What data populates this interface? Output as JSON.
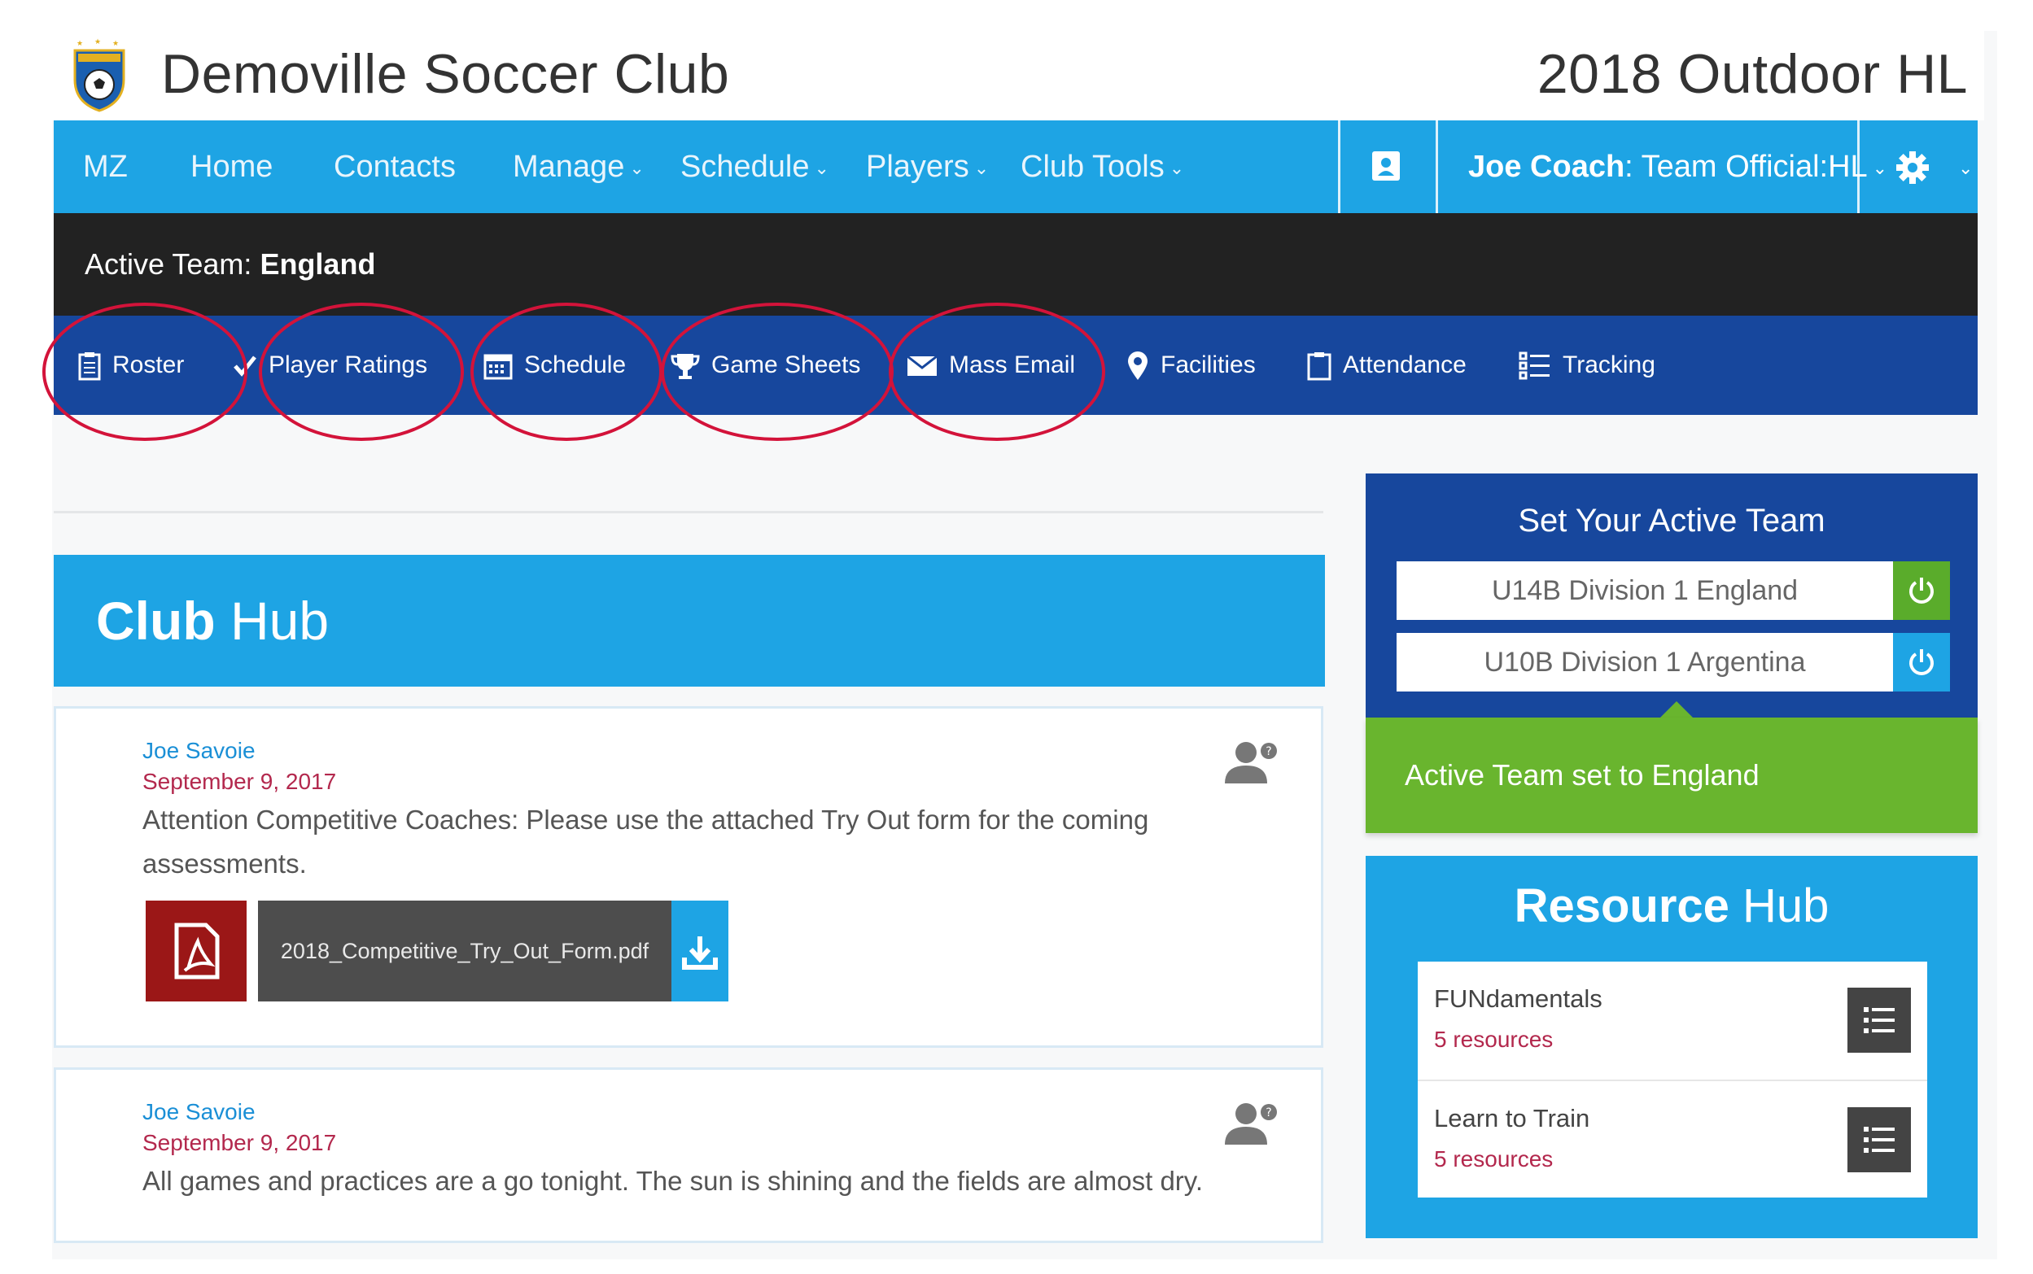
{
  "header": {
    "club_name": "Demoville Soccer Club",
    "season": "2018 Outdoor HL"
  },
  "main_nav": {
    "items": [
      {
        "label": "MZ",
        "dropdown": false
      },
      {
        "label": "Home",
        "dropdown": false
      },
      {
        "label": "Contacts",
        "dropdown": false
      },
      {
        "label": "Manage",
        "dropdown": true
      },
      {
        "label": "Schedule",
        "dropdown": true
      },
      {
        "label": "Players",
        "dropdown": true
      },
      {
        "label": "Club Tools",
        "dropdown": true
      }
    ],
    "user_name": "Joe Coach",
    "user_role": ": Team Official:HL",
    "contact_icon": "contact-card-icon",
    "settings_icon": "gear-icon"
  },
  "active_team_bar": {
    "label": "Active Team:",
    "team": "England"
  },
  "team_nav": {
    "items": [
      {
        "label": "Roster",
        "icon": "clipboard-icon"
      },
      {
        "label": "Player Ratings",
        "icon": "checkmark-icon"
      },
      {
        "label": "Schedule",
        "icon": "calendar-icon"
      },
      {
        "label": "Game Sheets",
        "icon": "trophy-icon"
      },
      {
        "label": "Mass Email",
        "icon": "envelope-icon"
      },
      {
        "label": "Facilities",
        "icon": "map-pin-icon"
      },
      {
        "label": "Attendance",
        "icon": "clipboard-icon"
      },
      {
        "label": "Tracking",
        "icon": "list-icon"
      }
    ],
    "highlight_color": "#d3133a"
  },
  "club_hub": {
    "title_bold": "Club",
    "title_rest": " Hub",
    "posts": [
      {
        "author": "Joe Savoie",
        "date": "September 9, 2017",
        "body": "Attention Competitive Coaches: Please use the attached Try Out form for the coming assessments.",
        "attachment": "2018_Competitive_Try_Out_Form.pdf"
      },
      {
        "author": "Joe Savoie",
        "date": "September 9, 2017",
        "body": "All games and practices are a go tonight. The sun is shining and the fields are almost dry."
      }
    ]
  },
  "active_team_panel": {
    "title": "Set Your Active Team",
    "teams": [
      {
        "name": "U14B Division 1 England",
        "active": true
      },
      {
        "name": "U10B Division 1 Argentina",
        "active": false
      }
    ],
    "success_message": "Active Team set to England"
  },
  "resource_hub": {
    "title_bold": "Resource",
    "title_rest": " Hub",
    "items": [
      {
        "name": "FUNdamentals",
        "count": "5 resources"
      },
      {
        "name": "Learn to Train",
        "count": "5 resources"
      }
    ]
  },
  "colors": {
    "primary_blue": "#1ea4e4",
    "dark_blue": "#17479d",
    "success_green": "#69b52e",
    "accent_red": "#b3284d"
  }
}
